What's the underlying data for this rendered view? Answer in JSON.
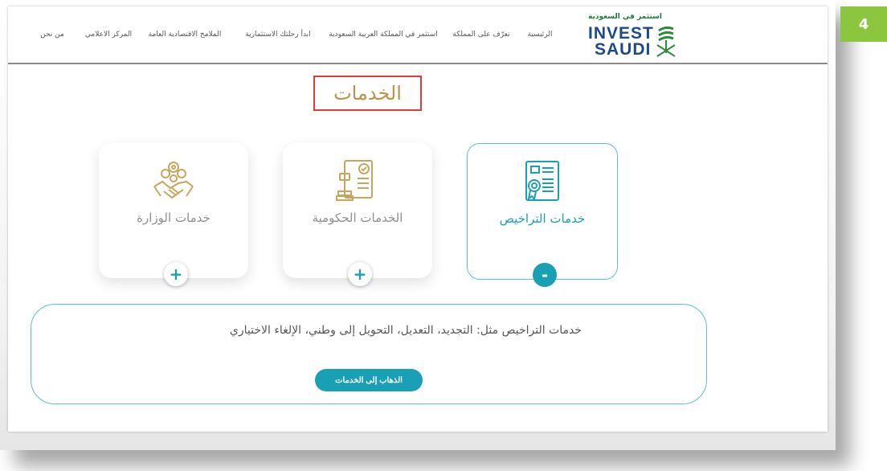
{
  "page_number": "4",
  "nav": {
    "items": [
      "من نحن",
      "المركز الاعلامي",
      "الملامح الاقتصادية العامة",
      "ابدأ رحلتك الاستثمارية",
      "استثمر في المملكة العربية السعودية",
      "تعرّف على المملكة",
      "الرئيسية"
    ]
  },
  "logo": {
    "arabic": "استثمر في السعودية",
    "line1": "INVEST",
    "line2": "SAUDI"
  },
  "page_title": "الخدمات",
  "cards": [
    {
      "label": "خدمات الوزارة",
      "toggle": "+",
      "active": false
    },
    {
      "label": "الخدمات الحكومية",
      "toggle": "+",
      "active": false
    },
    {
      "label": "خدمات التراخيص",
      "toggle": "-",
      "active": true
    }
  ],
  "detail": {
    "text": "خدمات التراخيص مثل: التجديد، التعديل، التحويل إلى وطني، الإلغاء الاختياري",
    "button_label": "الذهاب إلى الخدمات"
  },
  "colors": {
    "accent": "#1aa0b4",
    "gold": "#b9944a",
    "highlight": "#e53935",
    "badge": "#8cc63f"
  }
}
